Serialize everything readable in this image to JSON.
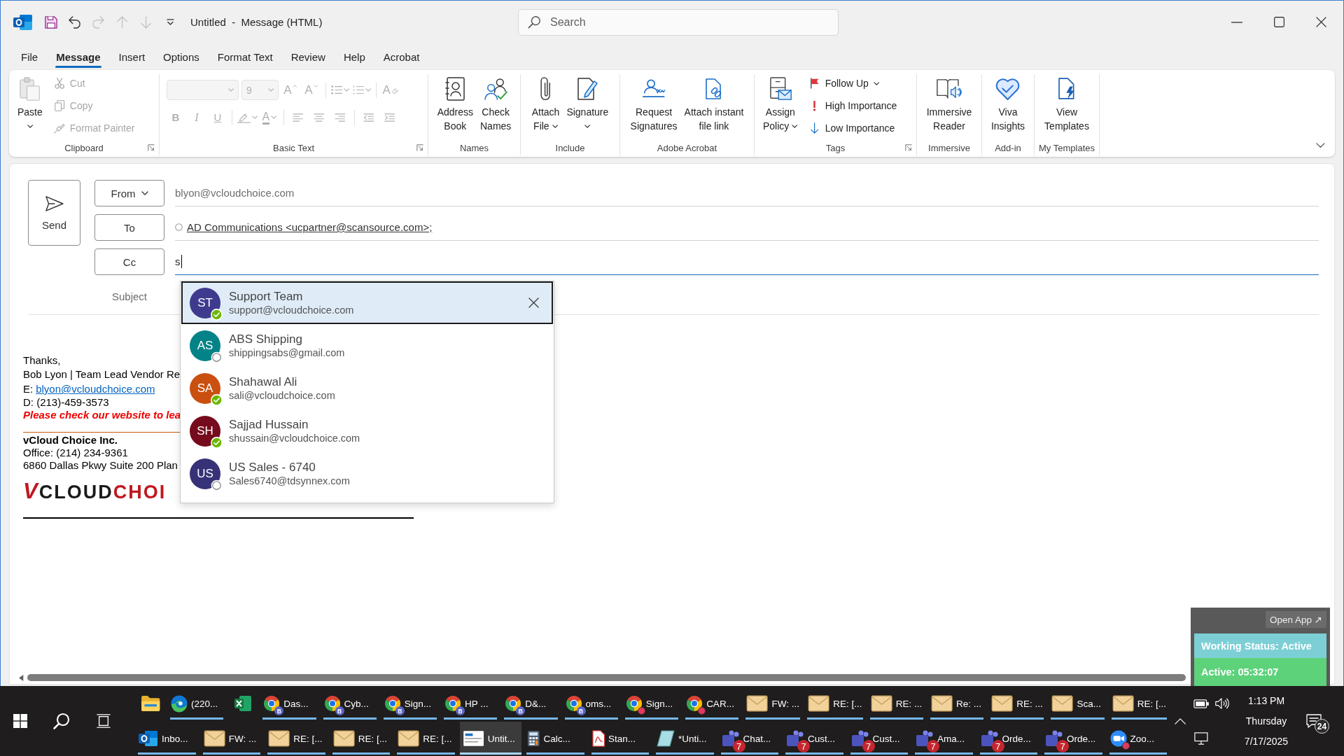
{
  "title_bar": {
    "quick_access": [
      {
        "kind": "save",
        "disabled": false
      },
      {
        "kind": "undo",
        "disabled": false
      },
      {
        "kind": "redo",
        "disabled": true
      },
      {
        "kind": "up",
        "disabled": true
      },
      {
        "kind": "down",
        "disabled": true
      },
      {
        "kind": "customize",
        "disabled": false
      }
    ],
    "title": "Untitled  -  Message (HTML)",
    "search": {
      "placeholder": "Search"
    }
  },
  "menu_tabs": [
    {
      "label": "File",
      "selected": false
    },
    {
      "label": "Message",
      "selected": true
    },
    {
      "label": "Insert",
      "selected": false
    },
    {
      "label": "Options",
      "selected": false
    },
    {
      "label": "Format Text",
      "selected": false
    },
    {
      "label": "Review",
      "selected": false
    },
    {
      "label": "Help",
      "selected": false
    },
    {
      "label": "Acrobat",
      "selected": false
    }
  ],
  "ribbon": {
    "groups": [
      {
        "kind": "actions",
        "label": "Clipboard",
        "launcher": true,
        "buttons": [
          {
            "kind": "paste",
            "lines": [
              "Paste"
            ],
            "menu": true
          }
        ],
        "small_buttons": [
          {
            "kind": "cut",
            "label": "Cut",
            "menu": false,
            "disabled": true
          },
          {
            "kind": "copy",
            "label": "Copy",
            "menu": false,
            "disabled": true
          },
          {
            "kind": "painter",
            "label": "Format Painter",
            "menu": false,
            "disabled": true
          }
        ]
      },
      {
        "kind": "format",
        "label": "Basic Text",
        "launcher": true,
        "font_name": {
          "disabled": true
        },
        "font_size": {
          "value": "9",
          "disabled": true
        },
        "row_1": [
          [
            {
              "kind": "grow",
              "label": "A",
              "menu": false,
              "disabled": true
            },
            {
              "kind": "shrink",
              "label": "A",
              "menu": false,
              "disabled": true
            }
          ],
          [
            {
              "kind": "bullets",
              "menu": true,
              "disabled": true
            },
            {
              "kind": "numbering",
              "menu": true,
              "disabled": true
            }
          ],
          [
            {
              "kind": "clear",
              "label": "A",
              "menu": false,
              "disabled": true
            }
          ]
        ],
        "row_2": [
          [
            {
              "kind": "bold",
              "label": "B",
              "menu": false,
              "disabled": true
            },
            {
              "kind": "italic",
              "label": "I",
              "menu": false,
              "disabled": true
            },
            {
              "kind": "underline",
              "label": "U",
              "menu": false,
              "disabled": true
            }
          ],
          [
            {
              "kind": "highlight",
              "menu": true,
              "disabled": true
            },
            {
              "kind": "fontcolor",
              "label": "A",
              "menu": true,
              "disabled": true
            }
          ],
          [
            {
              "kind": "alignleft",
              "menu": false,
              "disabled": true
            },
            {
              "kind": "center",
              "menu": false,
              "disabled": true
            },
            {
              "kind": "alignright",
              "menu": false,
              "disabled": true
            }
          ],
          [
            {
              "kind": "outdent",
              "menu": false,
              "disabled": true
            },
            {
              "kind": "indent",
              "menu": false,
              "disabled": true
            }
          ]
        ]
      },
      {
        "kind": "actions",
        "label": "Names",
        "buttons": [
          {
            "kind": "addressbook",
            "lines": [
              "Address",
              "Book"
            ],
            "menu": false
          },
          {
            "kind": "checknames",
            "lines": [
              "Check",
              "Names"
            ],
            "menu": false
          }
        ]
      },
      {
        "kind": "actions",
        "label": "Include",
        "buttons": [
          {
            "kind": "attach",
            "lines": [
              "Attach",
              "File"
            ],
            "menu": true
          },
          {
            "kind": "signature",
            "lines": [
              "Signature"
            ],
            "menu": true
          }
        ]
      },
      {
        "kind": "actions",
        "label": "Adobe Acrobat",
        "buttons": [
          {
            "kind": "request",
            "lines": [
              "Request",
              "Signatures"
            ],
            "menu": false
          },
          {
            "kind": "filelink",
            "lines": [
              "Attach instant",
              "file link"
            ],
            "menu": false
          }
        ]
      },
      {
        "kind": "actions",
        "label": "Tags",
        "launcher": true,
        "buttons": [
          {
            "kind": "policy",
            "lines": [
              "Assign",
              "Policy"
            ],
            "menu": true
          }
        ],
        "small_buttons": [
          {
            "kind": "flag",
            "label": "Follow Up",
            "menu": true,
            "disabled": false
          },
          {
            "kind": "high",
            "label": "High Importance",
            "menu": false,
            "disabled": false
          },
          {
            "kind": "low",
            "label": "Low Importance",
            "menu": false,
            "disabled": false
          }
        ]
      },
      {
        "kind": "actions",
        "label": "Immersive",
        "buttons": [
          {
            "kind": "reader",
            "lines": [
              "Immersive",
              "Reader"
            ],
            "menu": false
          }
        ]
      },
      {
        "kind": "actions",
        "label": "Add-in",
        "buttons": [
          {
            "kind": "viva",
            "lines": [
              "Viva",
              "Insights"
            ],
            "menu": false
          }
        ]
      },
      {
        "kind": "actions",
        "label": "My Templates",
        "buttons": [
          {
            "kind": "templates",
            "lines": [
              "View",
              "Templates"
            ],
            "menu": false
          }
        ]
      }
    ]
  },
  "compose": {
    "send": "Send",
    "from": {
      "label": "From",
      "value": "blyon@vcloudchoice.com"
    },
    "to": {
      "label": "To",
      "recipient": "AD Communications <ucpartner@scansource.com>;"
    },
    "cc": {
      "label": "Cc",
      "value": "s",
      "focused": true
    },
    "subject": {
      "label": "Subject"
    },
    "signature": {
      "closing": "Thanks,",
      "name_line": "Bob Lyon | Team Lead Vendor Re",
      "email_label": "E:",
      "email": "blyon@vcloudchoice.com",
      "phone": "D: (213)-459-3573",
      "notice": "Please check our website to lea",
      "company": "vCloud Choice Inc.",
      "office": "Office: (214) 234-9361",
      "address": "6860 Dallas Pkwy Suite 200 Plan",
      "logo": {
        "mark": "V",
        "word_1": "CLOUD",
        "word_2": "CHOI"
      }
    },
    "suggestions": [
      {
        "initials": "ST",
        "name": "Support Team",
        "email": "support@vcloudchoice.com",
        "color": "#3e3a8e",
        "available": true,
        "selected": true
      },
      {
        "initials": "AS",
        "name": "ABS Shipping",
        "email": "shippingsabs@gmail.com",
        "color": "#038387",
        "available": false,
        "selected": false
      },
      {
        "initials": "SA",
        "name": "Shahawal Ali",
        "email": "sali@vcloudchoice.com",
        "color": "#ca5010",
        "available": true,
        "selected": false
      },
      {
        "initials": "SH",
        "name": "Sajjad Hussain",
        "email": "shussain@vcloudchoice.com",
        "color": "#750b1c",
        "available": true,
        "selected": false
      },
      {
        "initials": "US",
        "name": "US Sales - 6740",
        "email": "Sales6740@tdsynnex.com",
        "color": "#373277",
        "available": false,
        "selected": false
      }
    ]
  },
  "widget": {
    "open_app": "Open App ↗",
    "status": "Working Status: Active",
    "timer": "Active: 05:32:07"
  },
  "taskbar": {
    "row_1": [
      {
        "kind": "folder",
        "running": false,
        "selected": false
      },
      {
        "kind": "edge",
        "label": "(220...",
        "running": true,
        "selected": false
      },
      {
        "kind": "excel",
        "running": false,
        "selected": false
      },
      {
        "kind": "chrome",
        "label": "Das...",
        "badge": {
          "kind": "profile",
          "text": "B"
        },
        "running": true,
        "selected": false
      },
      {
        "kind": "chrome",
        "label": "Cyb...",
        "badge": {
          "kind": "profile",
          "text": "B"
        },
        "running": true,
        "selected": false
      },
      {
        "kind": "chrome",
        "label": "Sign...",
        "badge": {
          "kind": "profile",
          "text": "B"
        },
        "running": true,
        "selected": false
      },
      {
        "kind": "chrome",
        "label": "HP ...",
        "badge": {
          "kind": "profile",
          "text": "B"
        },
        "running": true,
        "selected": false
      },
      {
        "kind": "chrome",
        "label": "D&...",
        "badge": {
          "kind": "profile",
          "text": "B"
        },
        "running": true,
        "selected": false
      },
      {
        "kind": "chrome",
        "label": "oms...",
        "badge": {
          "kind": "profile",
          "text": "B"
        },
        "running": true,
        "selected": false
      },
      {
        "kind": "chrome",
        "label": "Sign...",
        "badge": {
          "kind": "dot"
        },
        "running": true,
        "selected": false
      },
      {
        "kind": "chrome",
        "label": "CAR...",
        "badge": {
          "kind": "dot"
        },
        "running": true,
        "selected": false
      },
      {
        "kind": "mail",
        "label": "FW: ...",
        "running": true,
        "selected": false
      },
      {
        "kind": "mail",
        "label": "RE: [...",
        "running": true,
        "selected": false
      },
      {
        "kind": "mail",
        "label": "RE: ...",
        "running": true,
        "selected": false
      },
      {
        "kind": "mail",
        "label": "Re: ...",
        "running": true,
        "selected": false
      },
      {
        "kind": "mail",
        "label": "RE: ...",
        "running": true,
        "selected": false
      },
      {
        "kind": "mail",
        "label": "Sca...",
        "running": true,
        "selected": false
      },
      {
        "kind": "mail",
        "label": "RE: [...",
        "running": true,
        "selected": false
      }
    ],
    "row_2": [
      {
        "kind": "outlook",
        "label": "Inbo...",
        "running": true,
        "selected": false
      },
      {
        "kind": "mail",
        "label": "FW: ...",
        "running": true,
        "selected": false
      },
      {
        "kind": "mail",
        "label": "RE: [...",
        "running": true,
        "selected": false
      },
      {
        "kind": "mail",
        "label": "RE: [...",
        "running": true,
        "selected": false
      },
      {
        "kind": "mail",
        "label": "RE: [...",
        "running": true,
        "selected": false
      },
      {
        "kind": "compose",
        "label": "Untit...",
        "running": true,
        "selected": true
      },
      {
        "kind": "calc",
        "label": "Calc...",
        "running": true,
        "selected": false
      },
      {
        "kind": "pdf",
        "label": "Stan...",
        "running": true,
        "selected": false
      },
      {
        "kind": "notepad",
        "label": "*Unti...",
        "running": true,
        "selected": false
      },
      {
        "kind": "teams",
        "label": "Chat...",
        "badge": {
          "kind": "count",
          "text": "7"
        },
        "running": true,
        "selected": false
      },
      {
        "kind": "teams",
        "label": "Cust...",
        "badge": {
          "kind": "count",
          "text": "7"
        },
        "running": true,
        "selected": false
      },
      {
        "kind": "teams",
        "label": "Cust...",
        "badge": {
          "kind": "count",
          "text": "7"
        },
        "running": true,
        "selected": false
      },
      {
        "kind": "teams",
        "label": "Ama...",
        "badge": {
          "kind": "count",
          "text": "7"
        },
        "running": true,
        "selected": false
      },
      {
        "kind": "teams",
        "label": "Orde...",
        "badge": {
          "kind": "count",
          "text": "7"
        },
        "running": true,
        "selected": false
      },
      {
        "kind": "teams",
        "label": "Orde...",
        "badge": {
          "kind": "count",
          "text": "7"
        },
        "running": true,
        "selected": false
      },
      {
        "kind": "zoom",
        "label": "Zoo...",
        "badge": {
          "kind": "dot"
        },
        "running": true,
        "selected": false
      }
    ],
    "tray": {
      "time": "1:13 PM",
      "day": "Thursday",
      "date": "7/17/2025",
      "notifications": "24"
    }
  }
}
